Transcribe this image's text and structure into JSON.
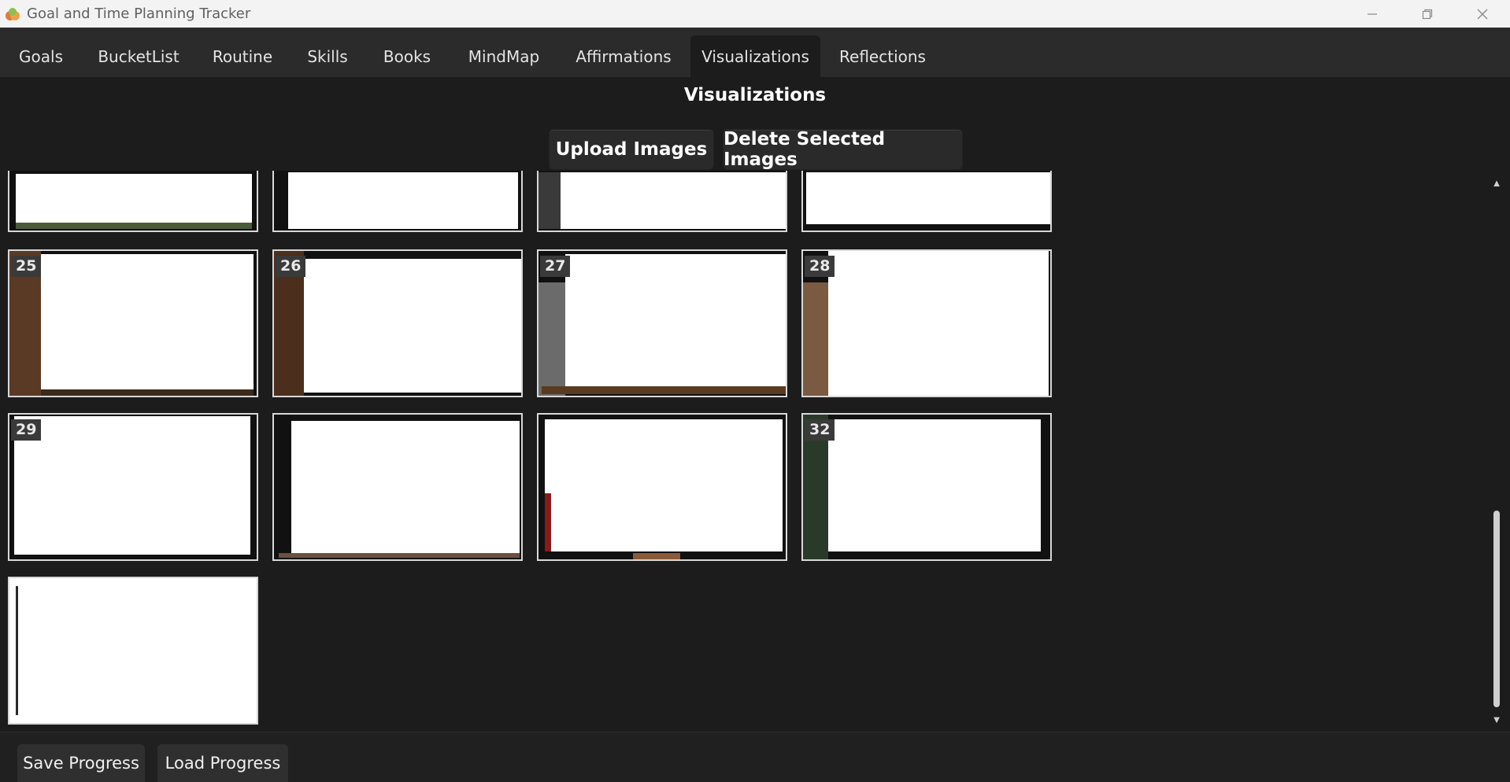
{
  "window": {
    "title": "Goal and Time Planning Tracker",
    "icon": "app-logo-icon",
    "controls": [
      "minimize-icon",
      "restore-icon",
      "close-icon"
    ]
  },
  "tabs": [
    {
      "label": "Goals",
      "active": false
    },
    {
      "label": "BucketList",
      "active": false
    },
    {
      "label": "Routine",
      "active": false
    },
    {
      "label": "Skills",
      "active": false
    },
    {
      "label": "Books",
      "active": false
    },
    {
      "label": "MindMap",
      "active": false
    },
    {
      "label": "Affirmations",
      "active": false
    },
    {
      "label": "Visualizations",
      "active": true
    },
    {
      "label": "Reflections",
      "active": false
    }
  ],
  "main": {
    "heading": "Visualizations",
    "upload_label": "Upload Images",
    "delete_label": "Delete Selected Images"
  },
  "gallery": {
    "numbers": {
      "n25": "25",
      "n26": "26",
      "n27": "27",
      "n28": "28",
      "n29": "29",
      "n32": "32"
    },
    "scroll_position": 0.85
  },
  "footer": {
    "save_label": "Save Progress",
    "load_label": "Load Progress"
  },
  "colors": {
    "background": "#1c1c1c",
    "tabbar": "#2b2b2b",
    "titlebar": "#f3f3f3",
    "thumb_border": "#d8d8d8"
  }
}
